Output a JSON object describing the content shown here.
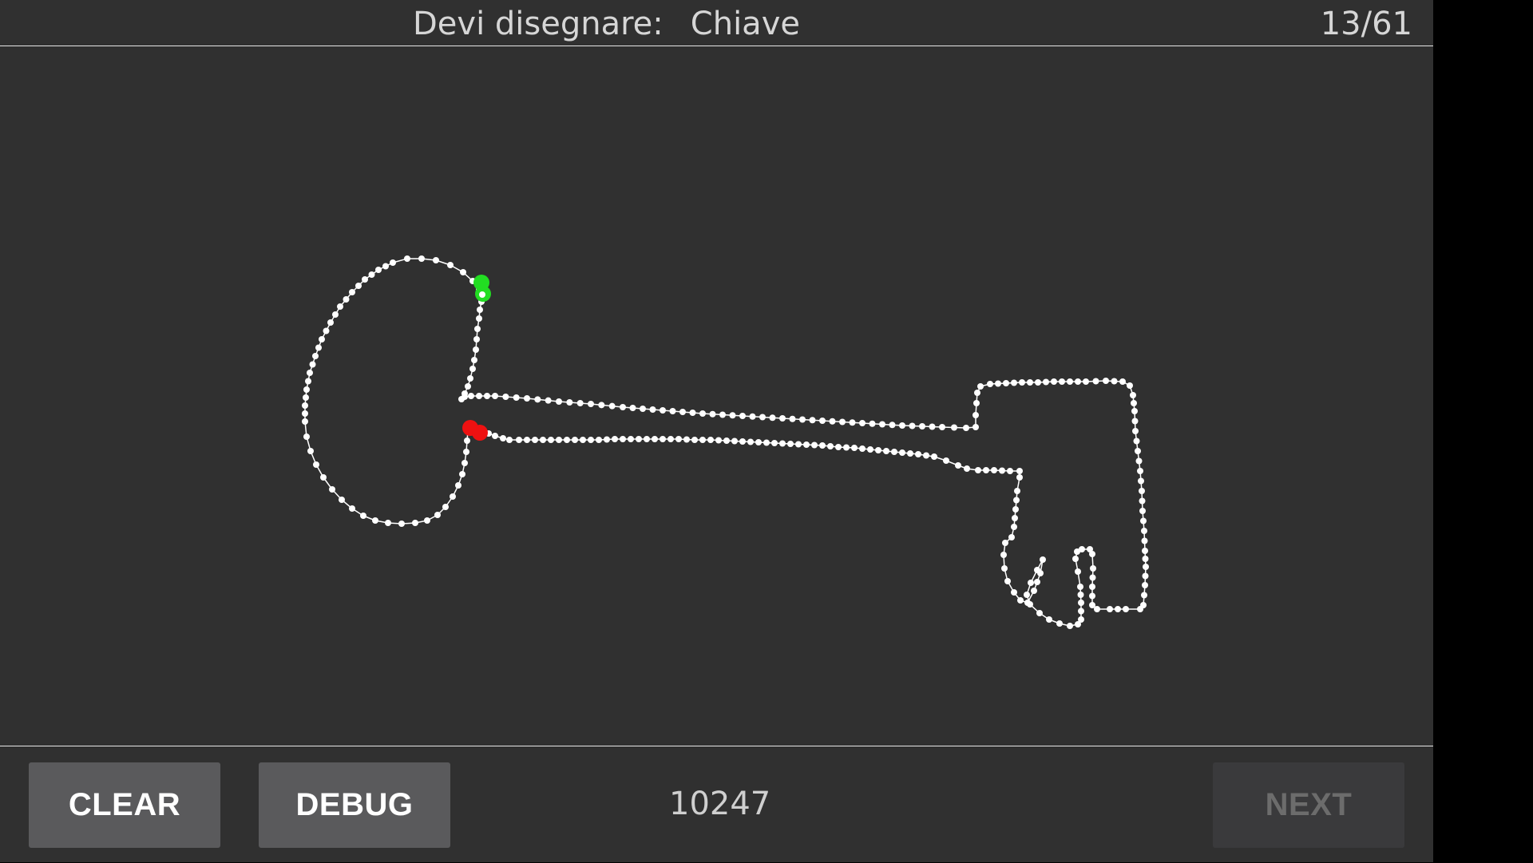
{
  "header": {
    "prompt_label": "Devi disegnare:",
    "prompt_word": "Chiave",
    "progress": "13/61"
  },
  "footer": {
    "clear_label": "CLEAR",
    "debug_label": "DEBUG",
    "score": "10247",
    "next_label": "NEXT"
  },
  "colors": {
    "background": "#303030",
    "stroke": "#ffffff",
    "start_marker": "#22dd22",
    "end_marker": "#ee1111",
    "button": "#5a5a5c",
    "button_disabled": "#3a3a3c"
  }
}
